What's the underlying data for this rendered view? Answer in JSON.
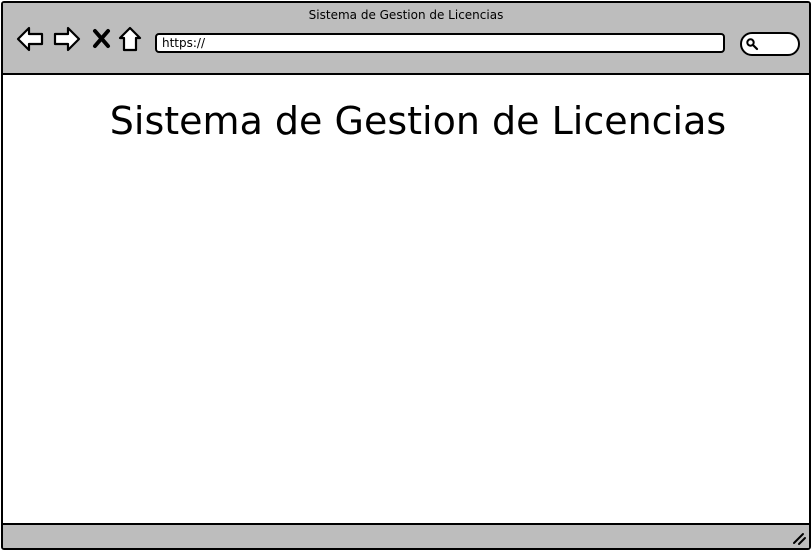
{
  "window": {
    "title": "Sistema de Gestion de Licencias"
  },
  "toolbar": {
    "back_icon": "back-arrow-icon",
    "forward_icon": "forward-arrow-icon",
    "stop_icon": "close-icon",
    "home_icon": "home-icon",
    "url": "https://",
    "search_icon": "search-icon"
  },
  "page": {
    "heading": "Sistema de Gestion de Licencias"
  },
  "status_bar": {
    "resize_icon": "resize-grip-icon"
  },
  "colors": {
    "chrome": "#bdbdbd",
    "border": "#000000",
    "content": "#ffffff"
  }
}
